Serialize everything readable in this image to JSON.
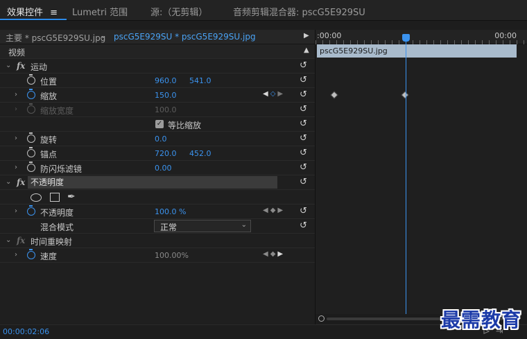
{
  "tabs": [
    {
      "label": "效果控件",
      "menu_icon": "≡"
    },
    {
      "label": "Lumetri 范围"
    },
    {
      "label": "源:（无剪辑）"
    },
    {
      "label": "音频剪辑混合器: pscG5E929SU"
    }
  ],
  "header": {
    "master": "主要 * pscG5E929SU.jpg",
    "clip": "pscG5E929SU * pscG5E929SU.jpg"
  },
  "section_video": "视频",
  "motion": {
    "label": "运动",
    "position": {
      "label": "位置",
      "x": "960.0",
      "y": "541.0"
    },
    "scale": {
      "label": "缩放",
      "value": "150.0"
    },
    "scale_width": {
      "label": "缩放宽度",
      "value": "100.0"
    },
    "uniform_scale": {
      "label": "等比缩放",
      "checked": true
    },
    "rotation": {
      "label": "旋转",
      "value": "0.0"
    },
    "anchor": {
      "label": "锚点",
      "x": "720.0",
      "y": "452.0"
    },
    "anti_flicker": {
      "label": "防闪烁滤镜",
      "value": "0.00"
    }
  },
  "opacity": {
    "label": "不透明度",
    "opacity_value": {
      "label": "不透明度",
      "value": "100.0 %"
    },
    "blend_mode": {
      "label": "混合模式",
      "value": "正常"
    }
  },
  "time_remap": {
    "label": "时间重映射",
    "speed": {
      "label": "速度",
      "value": "100.00%"
    }
  },
  "timeline": {
    "start": ":00:00",
    "end": "00:00",
    "clip_name": "pscG5E929SU.jpg"
  },
  "status": {
    "timecode": "00:00:02:06"
  },
  "watermark": "最需教育",
  "colors": {
    "accent": "#3b93ef",
    "clip_bar": "#a9bbcc",
    "watermark": "#1c3ba8"
  }
}
